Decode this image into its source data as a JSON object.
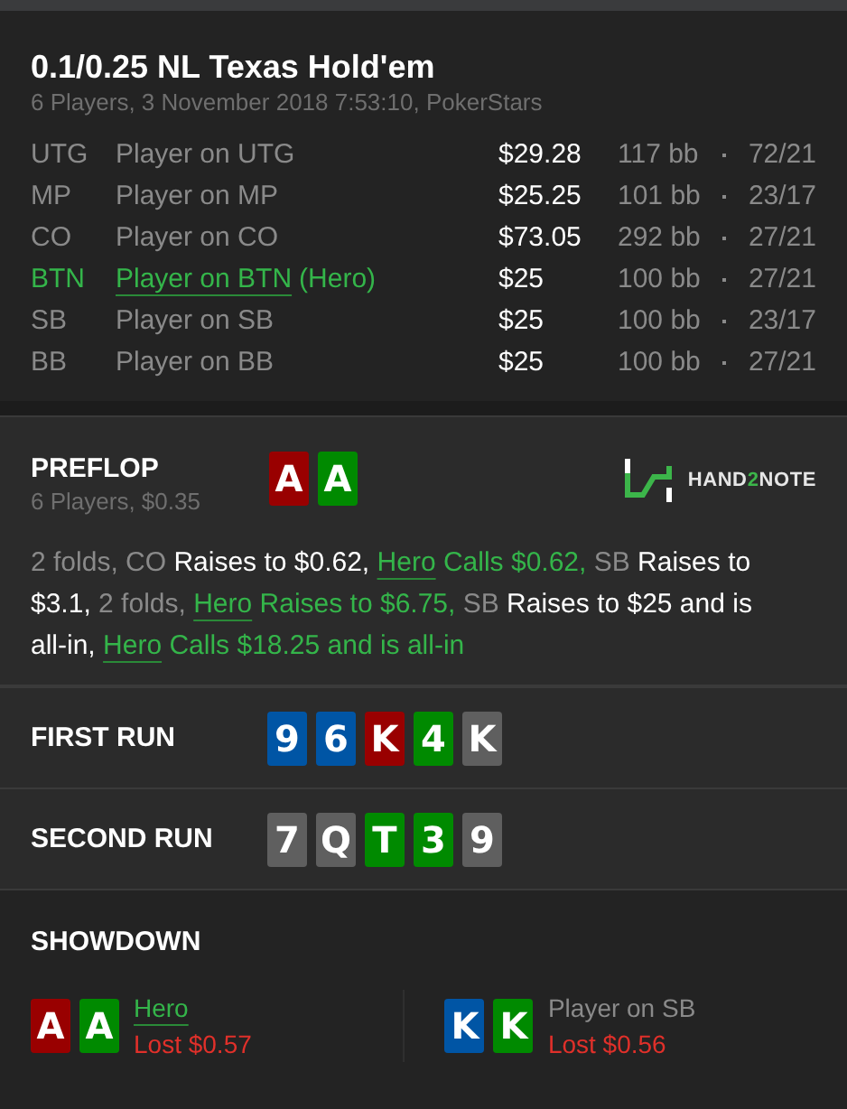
{
  "header": {
    "title": "0.1/0.25 NL Texas Hold'em",
    "subtitle": "6 Players, 3 November 2018 7:53:10, PokerStars"
  },
  "players": [
    {
      "position": "UTG",
      "name": "Player on UTG",
      "hero": false,
      "stack": "$29.28",
      "bb": "117 bb",
      "stats": "72/21"
    },
    {
      "position": "MP",
      "name": "Player on MP",
      "hero": false,
      "stack": "$25.25",
      "bb": "101 bb",
      "stats": "23/17"
    },
    {
      "position": "CO",
      "name": "Player on CO",
      "hero": false,
      "stack": "$73.05",
      "bb": "292 bb",
      "stats": "27/21"
    },
    {
      "position": "BTN",
      "name": "Player on BTN",
      "hero": true,
      "hero_tag": "(Hero)",
      "stack": "$25",
      "bb": "100 bb",
      "stats": "27/21"
    },
    {
      "position": "SB",
      "name": "Player on SB",
      "hero": false,
      "stack": "$25",
      "bb": "100 bb",
      "stats": "23/17"
    },
    {
      "position": "BB",
      "name": "Player on BB",
      "hero": false,
      "stack": "$25",
      "bb": "100 bb",
      "stats": "27/21"
    }
  ],
  "preflop": {
    "title": "PREFLOP",
    "subtitle": "6 Players, $0.35",
    "cards": [
      {
        "rank": "A",
        "color": "#990000"
      },
      {
        "rank": "A",
        "color": "#008a00"
      }
    ],
    "logo": {
      "prefix": "HAND",
      "accent": "2",
      "suffix": "NOTE"
    },
    "actions": [
      {
        "kind": "muted",
        "text": "2 folds, CO"
      },
      {
        "kind": "plain",
        "text": "Raises to $0.62,"
      },
      {
        "kind": "hero",
        "name": "Hero",
        "text": "Calls $0.62,"
      },
      {
        "kind": "muted",
        "text": "SB"
      },
      {
        "kind": "plain",
        "text": "Raises to $3.1,"
      },
      {
        "kind": "muted",
        "text": "2 folds,"
      },
      {
        "kind": "hero",
        "name": "Hero",
        "text": "Raises to $6.75,"
      },
      {
        "kind": "muted",
        "text": "SB"
      },
      {
        "kind": "plain",
        "text": "Raises to $25 and is all-in,"
      },
      {
        "kind": "hero",
        "name": "Hero",
        "text": "Calls $18.25 and is all-in"
      }
    ]
  },
  "runs": [
    {
      "title": "FIRST RUN",
      "cards": [
        {
          "rank": "9",
          "color": "#0055a5"
        },
        {
          "rank": "6",
          "color": "#0055a5"
        },
        {
          "rank": "K",
          "color": "#990000"
        },
        {
          "rank": "4",
          "color": "#008a00"
        },
        {
          "rank": "K",
          "color": "#5f5f5f"
        }
      ]
    },
    {
      "title": "SECOND RUN",
      "cards": [
        {
          "rank": "7",
          "color": "#5f5f5f"
        },
        {
          "rank": "Q",
          "color": "#5f5f5f"
        },
        {
          "rank": "T",
          "color": "#008a00"
        },
        {
          "rank": "3",
          "color": "#008a00"
        },
        {
          "rank": "9",
          "color": "#5f5f5f"
        }
      ]
    }
  ],
  "showdown": {
    "title": "SHOWDOWN",
    "players": [
      {
        "name": "Hero",
        "hero": true,
        "result": "Lost $0.57",
        "cards": [
          {
            "rank": "A",
            "color": "#990000"
          },
          {
            "rank": "A",
            "color": "#008a00"
          }
        ]
      },
      {
        "name": "Player on SB",
        "hero": false,
        "result": "Lost $0.56",
        "cards": [
          {
            "rank": "K",
            "color": "#0055a5"
          },
          {
            "rank": "K",
            "color": "#008a00"
          }
        ]
      }
    ]
  }
}
